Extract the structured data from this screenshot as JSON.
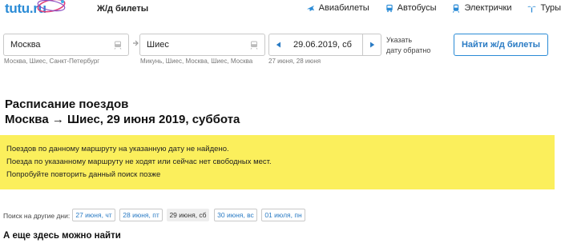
{
  "header": {
    "logo_text": "tutu.ru",
    "section_title": "Ж/д билеты",
    "nav": [
      {
        "label": "Авиабилеты",
        "icon": "plane-icon"
      },
      {
        "label": "Автобусы",
        "icon": "bus-icon"
      },
      {
        "label": "Электрички",
        "icon": "commuter-train-icon"
      },
      {
        "label": "Туры",
        "icon": "palm-tree-icon"
      }
    ]
  },
  "search": {
    "from": {
      "value": "Москва",
      "hint": "Москва, Шиес, Санкт-Петербург"
    },
    "to": {
      "value": "Шиес",
      "hint": "Микунь, Шиес, Москва, Шиес, Москва"
    },
    "date": {
      "value": "29.06.2019, сб",
      "hint": "27 июня, 28 июня"
    },
    "return_label_line1": "Указать",
    "return_label_line2": "дату обратно",
    "find_button": "Найти ж/д билеты"
  },
  "page": {
    "title_line1": "Расписание поездов",
    "title_line2": "Москва → Шиес, 29 июня 2019, суббота"
  },
  "alert": {
    "lines": [
      "Поездов по данному маршруту на указанную дату не найдено.",
      "Поезда по указанному маршруту не ходят или сейчас нет свободных мест.",
      "Попробуйте повторить данный поиск позже"
    ],
    "background": "#fbef5c"
  },
  "other_dates": {
    "label": "Поиск на другие дни:",
    "dates": [
      "27 июня, чт",
      "28 июня, пт",
      "29 июня, сб",
      "30 июня, вс",
      "01 июля, пн"
    ],
    "current_index": 2
  },
  "more": {
    "title": "А еще здесь можно найти"
  },
  "colors": {
    "accent": "#2a8bd6",
    "link": "#2a7bc4"
  }
}
